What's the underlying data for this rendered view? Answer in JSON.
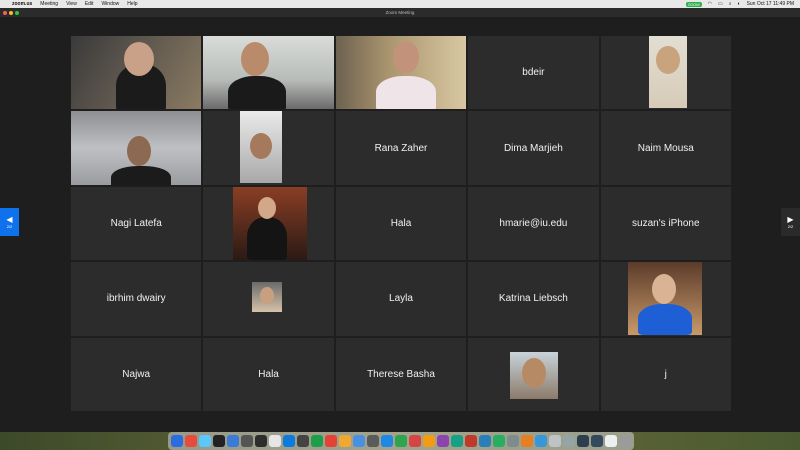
{
  "menubar": {
    "app_name": "zoom.us",
    "items": [
      "Meeting",
      "View",
      "Edit",
      "Window",
      "Help"
    ],
    "zoom_indicator": "ZOOM",
    "clock": "Sun Oct 17  11:49 PM"
  },
  "window": {
    "title": "Zoom Meeting"
  },
  "gallery": {
    "tiles": [
      {
        "type": "video",
        "name": ""
      },
      {
        "type": "video",
        "name": ""
      },
      {
        "type": "video",
        "name": "",
        "active": true
      },
      {
        "type": "name",
        "name": "bdeir"
      },
      {
        "type": "photo",
        "name": ""
      },
      {
        "type": "video",
        "name": ""
      },
      {
        "type": "photo",
        "name": ""
      },
      {
        "type": "name",
        "name": "Rana Zaher"
      },
      {
        "type": "name",
        "name": "Dima Marjieh"
      },
      {
        "type": "name",
        "name": "Naim Mousa"
      },
      {
        "type": "name",
        "name": "Nagi Latefa"
      },
      {
        "type": "photo",
        "name": ""
      },
      {
        "type": "name",
        "name": "Hala"
      },
      {
        "type": "name",
        "name": "hmarie@iu.edu"
      },
      {
        "type": "name",
        "name": "suzan's iPhone"
      },
      {
        "type": "name",
        "name": "ibrhim dwairy"
      },
      {
        "type": "photo",
        "name": ""
      },
      {
        "type": "name",
        "name": "Layla"
      },
      {
        "type": "name",
        "name": "Katrina Liebsch"
      },
      {
        "type": "photo",
        "name": ""
      },
      {
        "type": "name",
        "name": "Najwa"
      },
      {
        "type": "name",
        "name": "Hala"
      },
      {
        "type": "name",
        "name": "Therese Basha"
      },
      {
        "type": "photo",
        "name": ""
      },
      {
        "type": "name",
        "name": "j"
      }
    ]
  },
  "paging": {
    "left_label": "2/2",
    "right_label": "2/2"
  },
  "dock": {
    "icon_colors": [
      "#2b6de0",
      "#e84a3c",
      "#5ac8fa",
      "#222222",
      "#3a7bd5",
      "#555555",
      "#2d2d2d",
      "#e6e6e6",
      "#0c7bdc",
      "#444444",
      "#1c9e4b",
      "#e34234",
      "#f0a830",
      "#4a90e2",
      "#5b5b5b",
      "#1e88e5",
      "#2ea44f",
      "#d64541",
      "#f39c12",
      "#8e44ad",
      "#16a085",
      "#c0392b",
      "#2980b9",
      "#27ae60",
      "#7f8c8d",
      "#e67e22",
      "#3498db",
      "#bdc3c7",
      "#95a5a6",
      "#2c3e50",
      "#34495e",
      "#ecf0f1",
      "#9b9b9b"
    ]
  }
}
